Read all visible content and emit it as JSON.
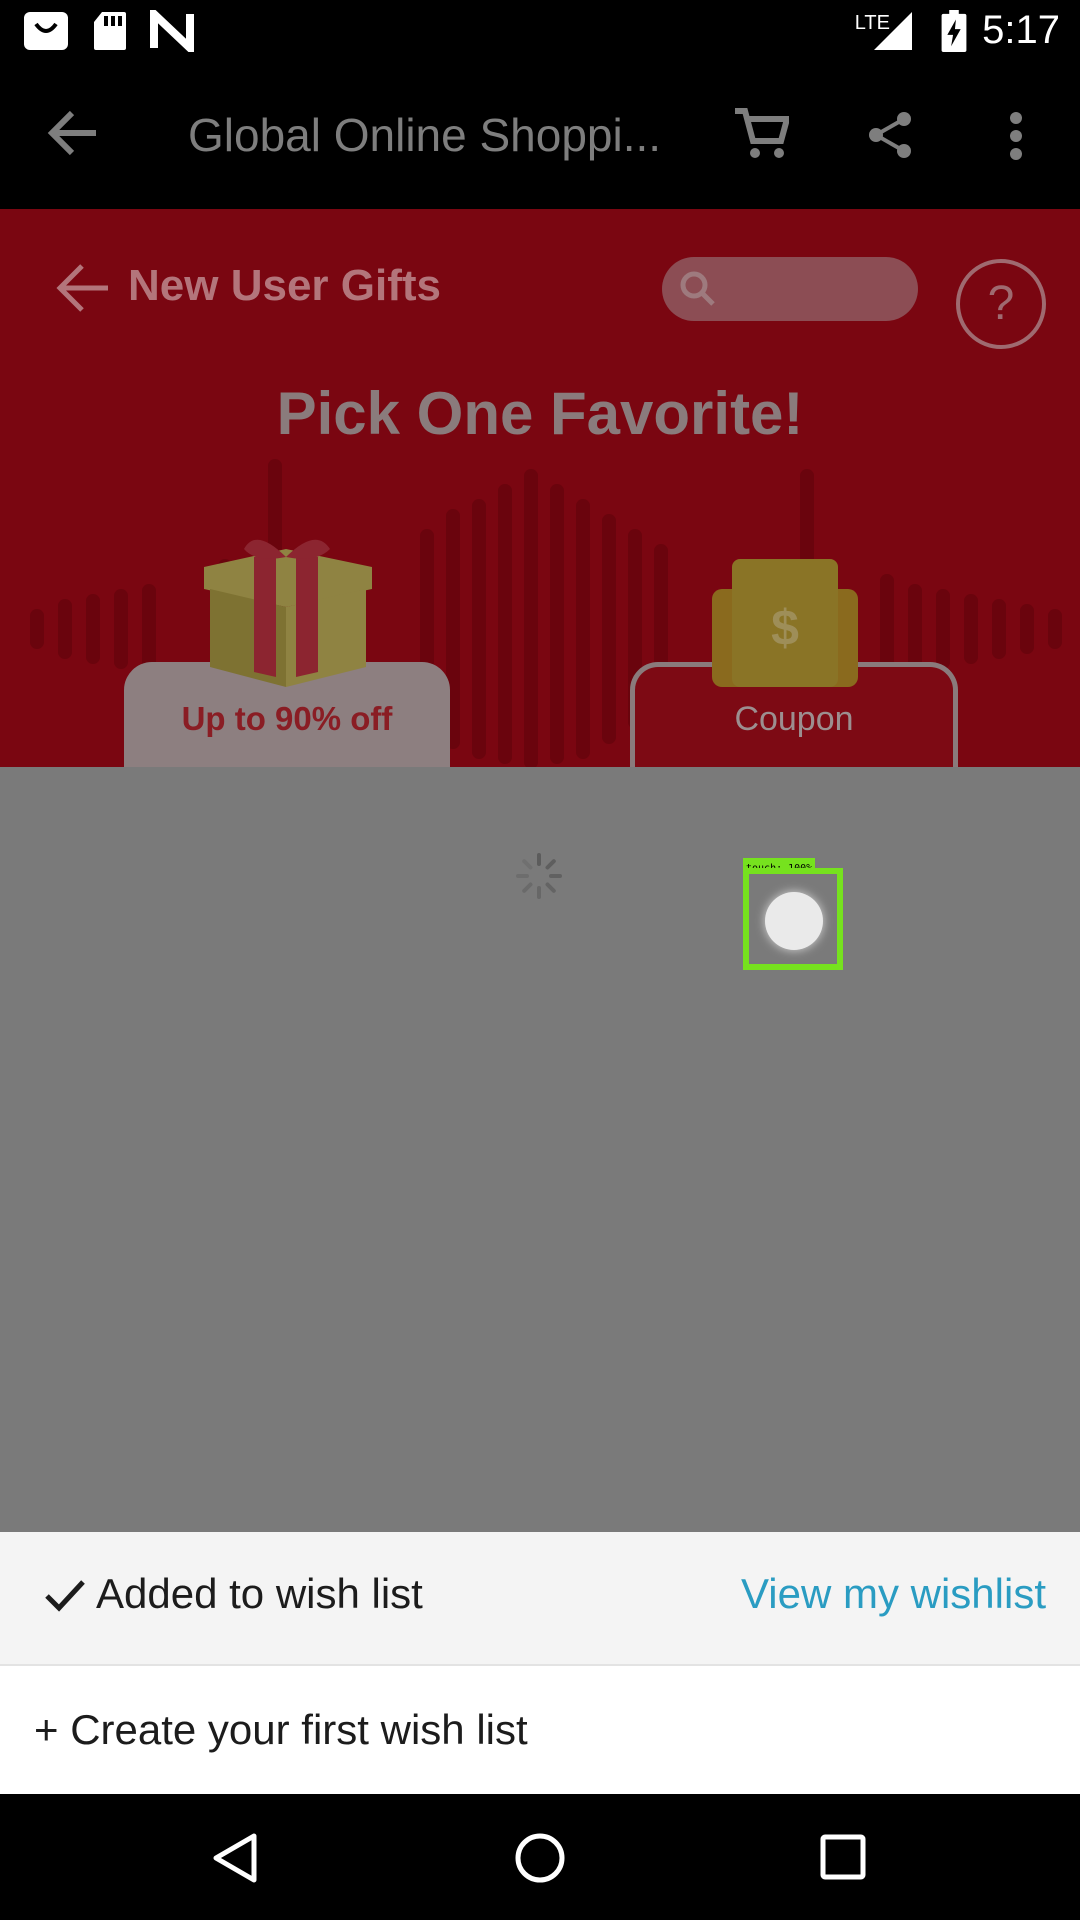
{
  "status_bar": {
    "time": "5:17",
    "network": "LTE",
    "icons": [
      "shopping-bag-icon",
      "sd-card-icon",
      "n-icon",
      "lte-signal-icon",
      "battery-charging-icon"
    ]
  },
  "app_bar": {
    "title": "Global Online Shoppi...",
    "icons": [
      "back-arrow-icon",
      "cart-icon",
      "share-icon",
      "more-vert-icon"
    ]
  },
  "page": {
    "subtitle": "New User Gifts",
    "help_symbol": "?",
    "headline": "Pick One Favorite!",
    "tabs": [
      {
        "label": "Up to 90% off"
      },
      {
        "label": "Coupon"
      }
    ],
    "coupon_symbol": "$"
  },
  "touch_overlay": {
    "label": "touch: 100%"
  },
  "bottom_sheet": {
    "added_label": "Added to wish list",
    "view_label": "View my wishlist",
    "create_label": "+ Create your first wish list"
  },
  "colors": {
    "banner_red": "#7a0611",
    "link_blue": "#2a9cc2",
    "touch_green": "#76e21e"
  }
}
